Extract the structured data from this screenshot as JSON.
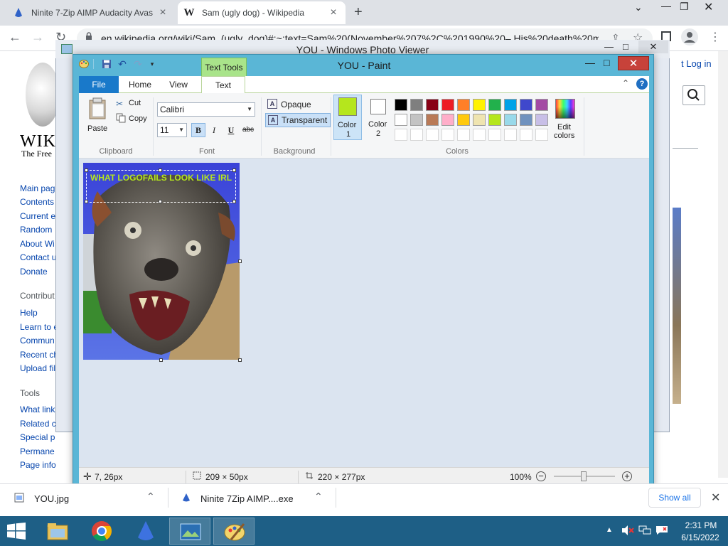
{
  "browser": {
    "tabs": [
      {
        "title": "Ninite 7-Zip AIMP Audacity Avas",
        "active": false
      },
      {
        "title": "Sam (ugly dog) - Wikipedia",
        "active": true
      }
    ],
    "url": "en.wikipedia.org/wiki/Sam_(ugly_dog)#:~:text=Sam%20(November%207%2C%201990%20– His%20death%20ma",
    "new_tab": "+"
  },
  "wiki": {
    "wordmark": "WIKI",
    "tagline": "The Free",
    "login": "t Log in",
    "nav": [
      "Main pag",
      "Contents",
      "Current e",
      "Random",
      "About Wi",
      "Contact u",
      "Donate"
    ],
    "contribute_heading": "Contribut",
    "contribute": [
      "Help",
      "Learn to e",
      "Commun",
      "Recent ch",
      "Upload fil"
    ],
    "tools_heading": "Tools",
    "tools": [
      "What link",
      "Related c",
      "Special p",
      "Permane",
      "Page info"
    ]
  },
  "photo_viewer": {
    "title": "YOU - Windows Photo Viewer"
  },
  "paint": {
    "title": "YOU - Paint",
    "context_tab": "Text Tools",
    "tabs": {
      "file": "File",
      "home": "Home",
      "view": "View",
      "text": "Text"
    },
    "clipboard": {
      "paste": "Paste",
      "cut": "Cut",
      "copy": "Copy",
      "label": "Clipboard"
    },
    "font": {
      "family": "Calibri",
      "size": "11",
      "bold": "B",
      "italic": "I",
      "underline": "U",
      "strike": "abc",
      "label": "Font"
    },
    "background": {
      "opaque": "Opaque",
      "transparent": "Transparent",
      "label": "Background"
    },
    "colors": {
      "color1_label": "Color",
      "color1_num": "1",
      "color2_label": "Color",
      "color2_num": "2",
      "edit_label": "Edit",
      "edit_label2": "colors",
      "label": "Colors",
      "color1": "#b5e61d",
      "color2": "#ffffff",
      "palette_row1": [
        "#000000",
        "#7f7f7f",
        "#880015",
        "#ed1c24",
        "#ff7f27",
        "#fff200",
        "#22b14c",
        "#00a2e8",
        "#3f48cc",
        "#a349a4"
      ],
      "palette_row2": [
        "#ffffff",
        "#c3c3c3",
        "#b97a57",
        "#ffaec9",
        "#ffc90e",
        "#efe4b0",
        "#b5e61d",
        "#99d9ea",
        "#7092be",
        "#c8bfe7"
      ]
    },
    "canvas_text": "WHAT LOGOFAILS LOOK LIKE IRL",
    "status": {
      "cursor": "7, 26px",
      "selection": "209 × 50px",
      "image_size": "220 × 277px",
      "zoom": "100%"
    }
  },
  "downloads": {
    "items": [
      "YOU.jpg",
      "Ninite 7Zip AIMP....exe"
    ],
    "show_all": "Show all"
  },
  "taskbar": {
    "time": "2:31 PM",
    "date": "6/15/2022"
  }
}
